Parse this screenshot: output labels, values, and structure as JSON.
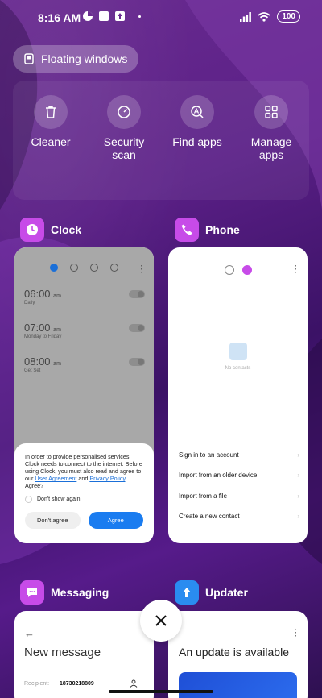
{
  "status_bar": {
    "time": "8:16 AM",
    "battery": "100"
  },
  "floating_windows": {
    "label": "Floating windows"
  },
  "quick_actions": [
    {
      "label": "Cleaner",
      "icon": "trash-icon"
    },
    {
      "label": "Security scan",
      "icon": "gauge-icon"
    },
    {
      "label": "Find apps",
      "icon": "find-apps-icon"
    },
    {
      "label": "Manage apps",
      "icon": "grid-icon"
    }
  ],
  "apps": {
    "clock": {
      "name": "Clock",
      "alarms": [
        {
          "time": "06:00",
          "suffix": "am",
          "sub": "Daily"
        },
        {
          "time": "07:00",
          "suffix": "am",
          "sub": "Monday to Friday"
        },
        {
          "time": "08:00",
          "suffix": "am",
          "sub": "Get Set"
        }
      ],
      "dialog": {
        "message_start": "In order to provide personalised services, Clock needs to connect to the internet. Before using Clock, you must also read and agree to our ",
        "link1": "User Agreement",
        "and": " and ",
        "link2": "Privacy Policy",
        "message_end": ". Agree?",
        "checkbox_label": "Don't show again",
        "decline": "Don't agree",
        "accept": "Agree"
      }
    },
    "phone": {
      "name": "Phone",
      "empty_text": "No contacts",
      "options": [
        "Sign in to an account",
        "Import from an older device",
        "Import from a file",
        "Create a new contact"
      ]
    },
    "messaging": {
      "name": "Messaging",
      "title": "New message",
      "recipient_label": "Recipient:",
      "recipient_value": "18730218809"
    },
    "updater": {
      "name": "Updater",
      "title": "An update is available"
    }
  },
  "colors": {
    "clock_icon": "#c74be8",
    "phone_icon": "#c74be8",
    "messaging_icon": "#c74be8",
    "updater_icon": "#2a8cf0",
    "accent_blue": "#1a7cf0"
  }
}
